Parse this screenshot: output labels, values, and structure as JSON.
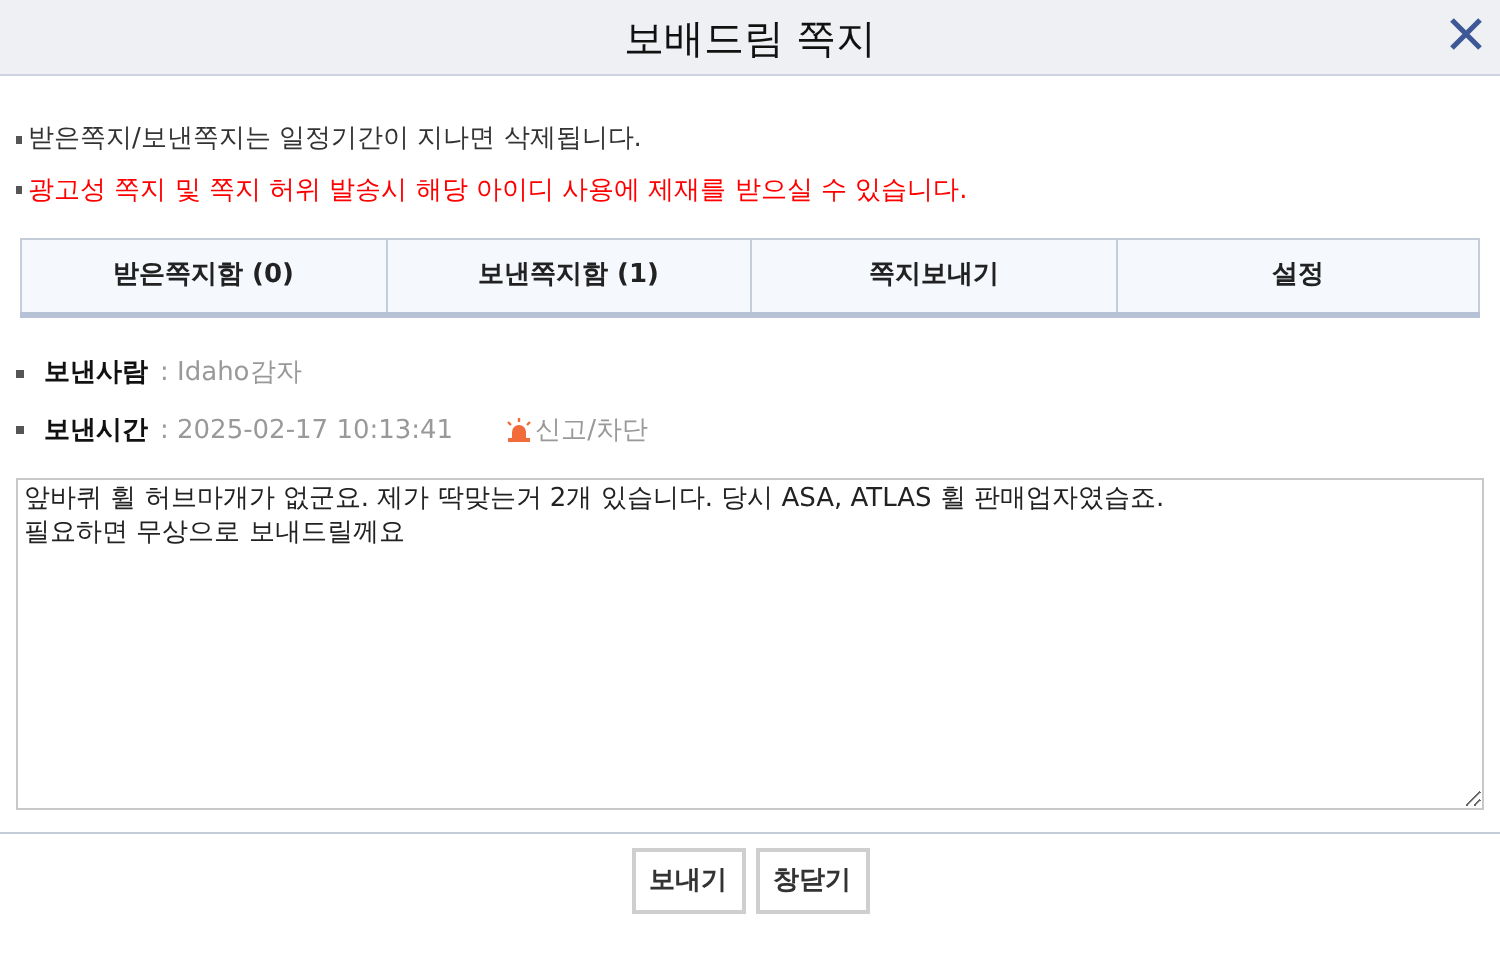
{
  "window": {
    "title": "보배드림 쪽지"
  },
  "notices": [
    {
      "text": "받은쪽지/보낸쪽지는 일정기간이 지나면 삭제됩니다.",
      "kind": "info"
    },
    {
      "text": "광고성 쪽지 및 쪽지 허위 발송시 해당 아이디 사용에 제재를 받으실 수 있습니다.",
      "kind": "warning"
    }
  ],
  "tabs": [
    {
      "label": "받은쪽지함 (0)"
    },
    {
      "label": "보낸쪽지함 (1)"
    },
    {
      "label": "쪽지보내기"
    },
    {
      "label": "설정"
    }
  ],
  "fields": [
    {
      "label": "보낸사람",
      "value": ": Idaho감자"
    },
    {
      "label": "보낸시간",
      "value": ": 2025-02-17 10:13:41",
      "action": "신고/차단"
    }
  ],
  "message": {
    "value": "앞바퀴 휠 허브마개가 없군요. 제가 딱맞는거 2개 있습니다. 당시 ASA, ATLAS 휠 판매업자였습죠.\n필요하면 무상으로 보내드릴께요"
  },
  "buttons": [
    "보내기",
    "창닫기"
  ]
}
